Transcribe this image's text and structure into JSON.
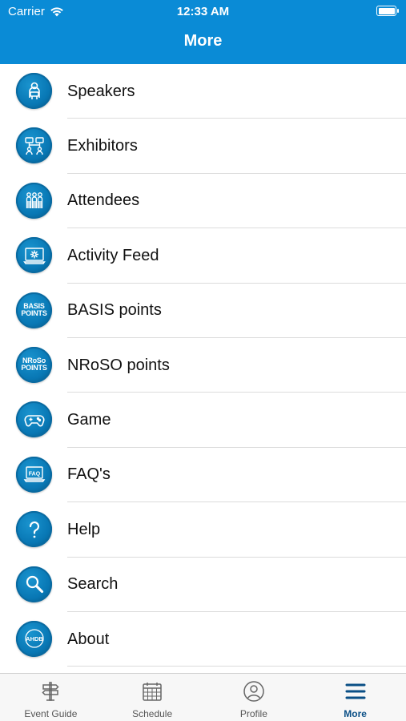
{
  "status_bar": {
    "carrier": "Carrier",
    "time": "12:33 AM"
  },
  "header": {
    "title": "More"
  },
  "menu": [
    {
      "label": "Speakers",
      "icon": "speaker-icon"
    },
    {
      "label": "Exhibitors",
      "icon": "exhibitors-icon"
    },
    {
      "label": "Attendees",
      "icon": "attendees-icon"
    },
    {
      "label": "Activity Feed",
      "icon": "activity-feed-icon"
    },
    {
      "label": "BASIS points",
      "icon": "basis-points-icon",
      "icon_text": [
        "BASIS",
        "POINTS"
      ]
    },
    {
      "label": "NRoSO points",
      "icon": "nroso-points-icon",
      "icon_text": [
        "NRoSo",
        "POINTS"
      ]
    },
    {
      "label": "Game",
      "icon": "gamepad-icon"
    },
    {
      "label": "FAQ's",
      "icon": "faq-icon",
      "icon_text": [
        "FAQ"
      ]
    },
    {
      "label": "Help",
      "icon": "question-icon"
    },
    {
      "label": "Search",
      "icon": "magnifier-icon"
    },
    {
      "label": "About",
      "icon": "ahdb-icon",
      "icon_text": [
        "AHDB"
      ]
    }
  ],
  "tabs": [
    {
      "label": "Event Guide",
      "icon": "signpost-icon"
    },
    {
      "label": "Schedule",
      "icon": "calendar-icon"
    },
    {
      "label": "Profile",
      "icon": "profile-icon"
    },
    {
      "label": "More",
      "icon": "hamburger-icon",
      "active": true
    }
  ],
  "colors": {
    "header": "#0a8bd6",
    "icon_circle": "#0877b4",
    "tab_active": "#0a4f86"
  }
}
